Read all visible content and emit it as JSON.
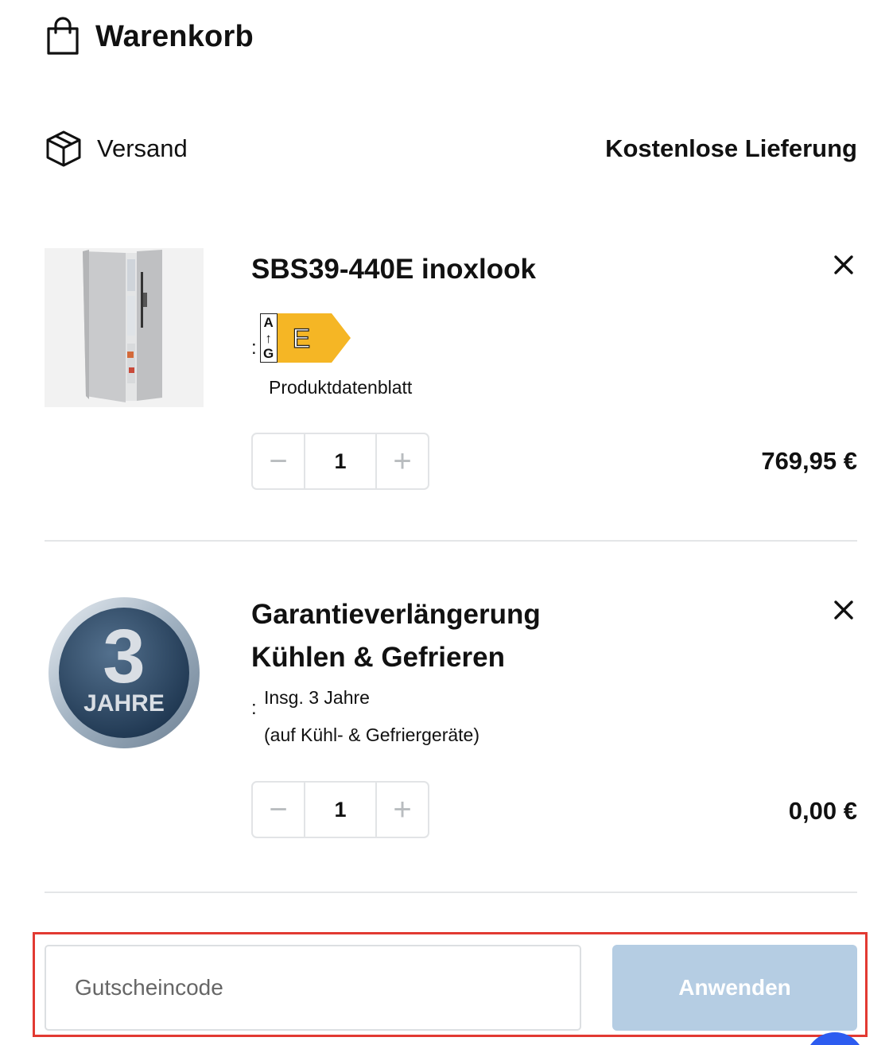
{
  "header": {
    "title": "Warenkorb",
    "icon": "shopping-bag-icon"
  },
  "shipping": {
    "label": "Versand",
    "value": "Kostenlose Lieferung",
    "icon": "package-icon"
  },
  "items": [
    {
      "name": "SBS39-440E inoxlook",
      "energy_label": {
        "scale_top": "A",
        "scale_bottom": "G",
        "class": "E",
        "class_color": "#f5b625",
        "separator": ":"
      },
      "datasheet_link": "Produktdatenblatt",
      "quantity": "1",
      "price": "769,95 €"
    },
    {
      "name_line1": "Garantieverlängerung",
      "name_line2": "Kühlen & Gefrieren",
      "badge_number": "3",
      "badge_text": "JAHRE",
      "meta_separator": ":",
      "meta_line1": "Insg. 3 Jahre",
      "meta_line2": "(auf Kühl- & Gefriergeräte)",
      "quantity": "1",
      "price": "0,00 €"
    }
  ],
  "stepper": {
    "minus": "−",
    "plus": "+"
  },
  "coupon": {
    "placeholder": "Gutscheincode",
    "apply_label": "Anwenden"
  },
  "colors": {
    "apply_button": "#b5cde3",
    "highlight_frame": "#e23a32",
    "chat_bubble": "#2d5cf0"
  }
}
